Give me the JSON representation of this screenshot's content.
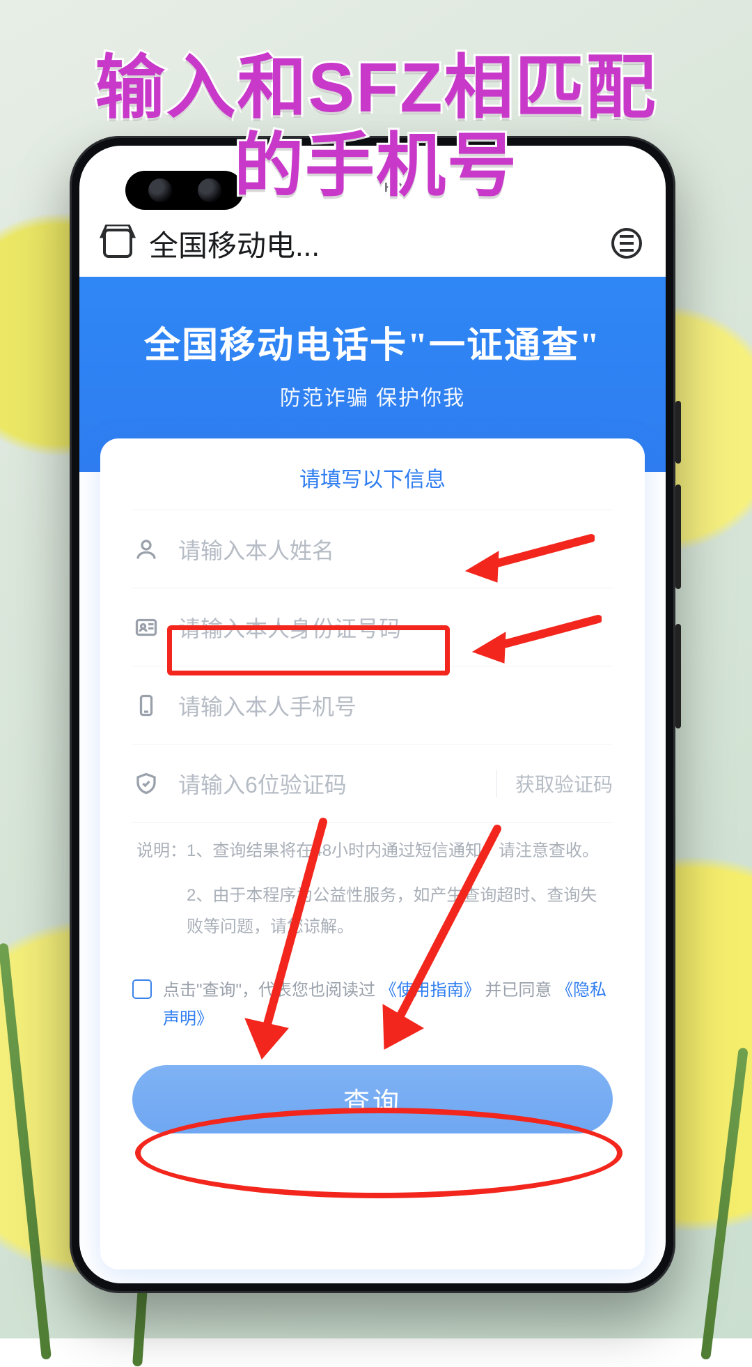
{
  "overlay": {
    "line1": "输入和SFZ相匹配",
    "line2": "的手机号"
  },
  "statusbar": {
    "hd": "HD"
  },
  "chrome": {
    "title": "全国移动电..."
  },
  "hero": {
    "title_pre": "全国移动电话卡",
    "title_quote": "\"一证通查\"",
    "subtitle": "防范诈骗 保护你我"
  },
  "form": {
    "header": "请填写以下信息",
    "name_ph": "请输入本人姓名",
    "id_ph": "请输入本人身份证号码",
    "phone_ph": "请输入本人手机号",
    "code_ph": "请输入6位验证码",
    "get_code": "获取验证码"
  },
  "notes": {
    "label": "说明：",
    "n1": "1、查询结果将在48小时内通过短信通知，请注意查收。",
    "n2": "2、由于本程序为公益性服务，如产生查询超时、查询失败等问题，请您谅解。"
  },
  "agree": {
    "pre": "点击\"查询\"，代表您也阅读过",
    "guide": "《使用指南》",
    "mid": "并已同意",
    "privacy": "《隐私声明》"
  },
  "submit": "查询"
}
